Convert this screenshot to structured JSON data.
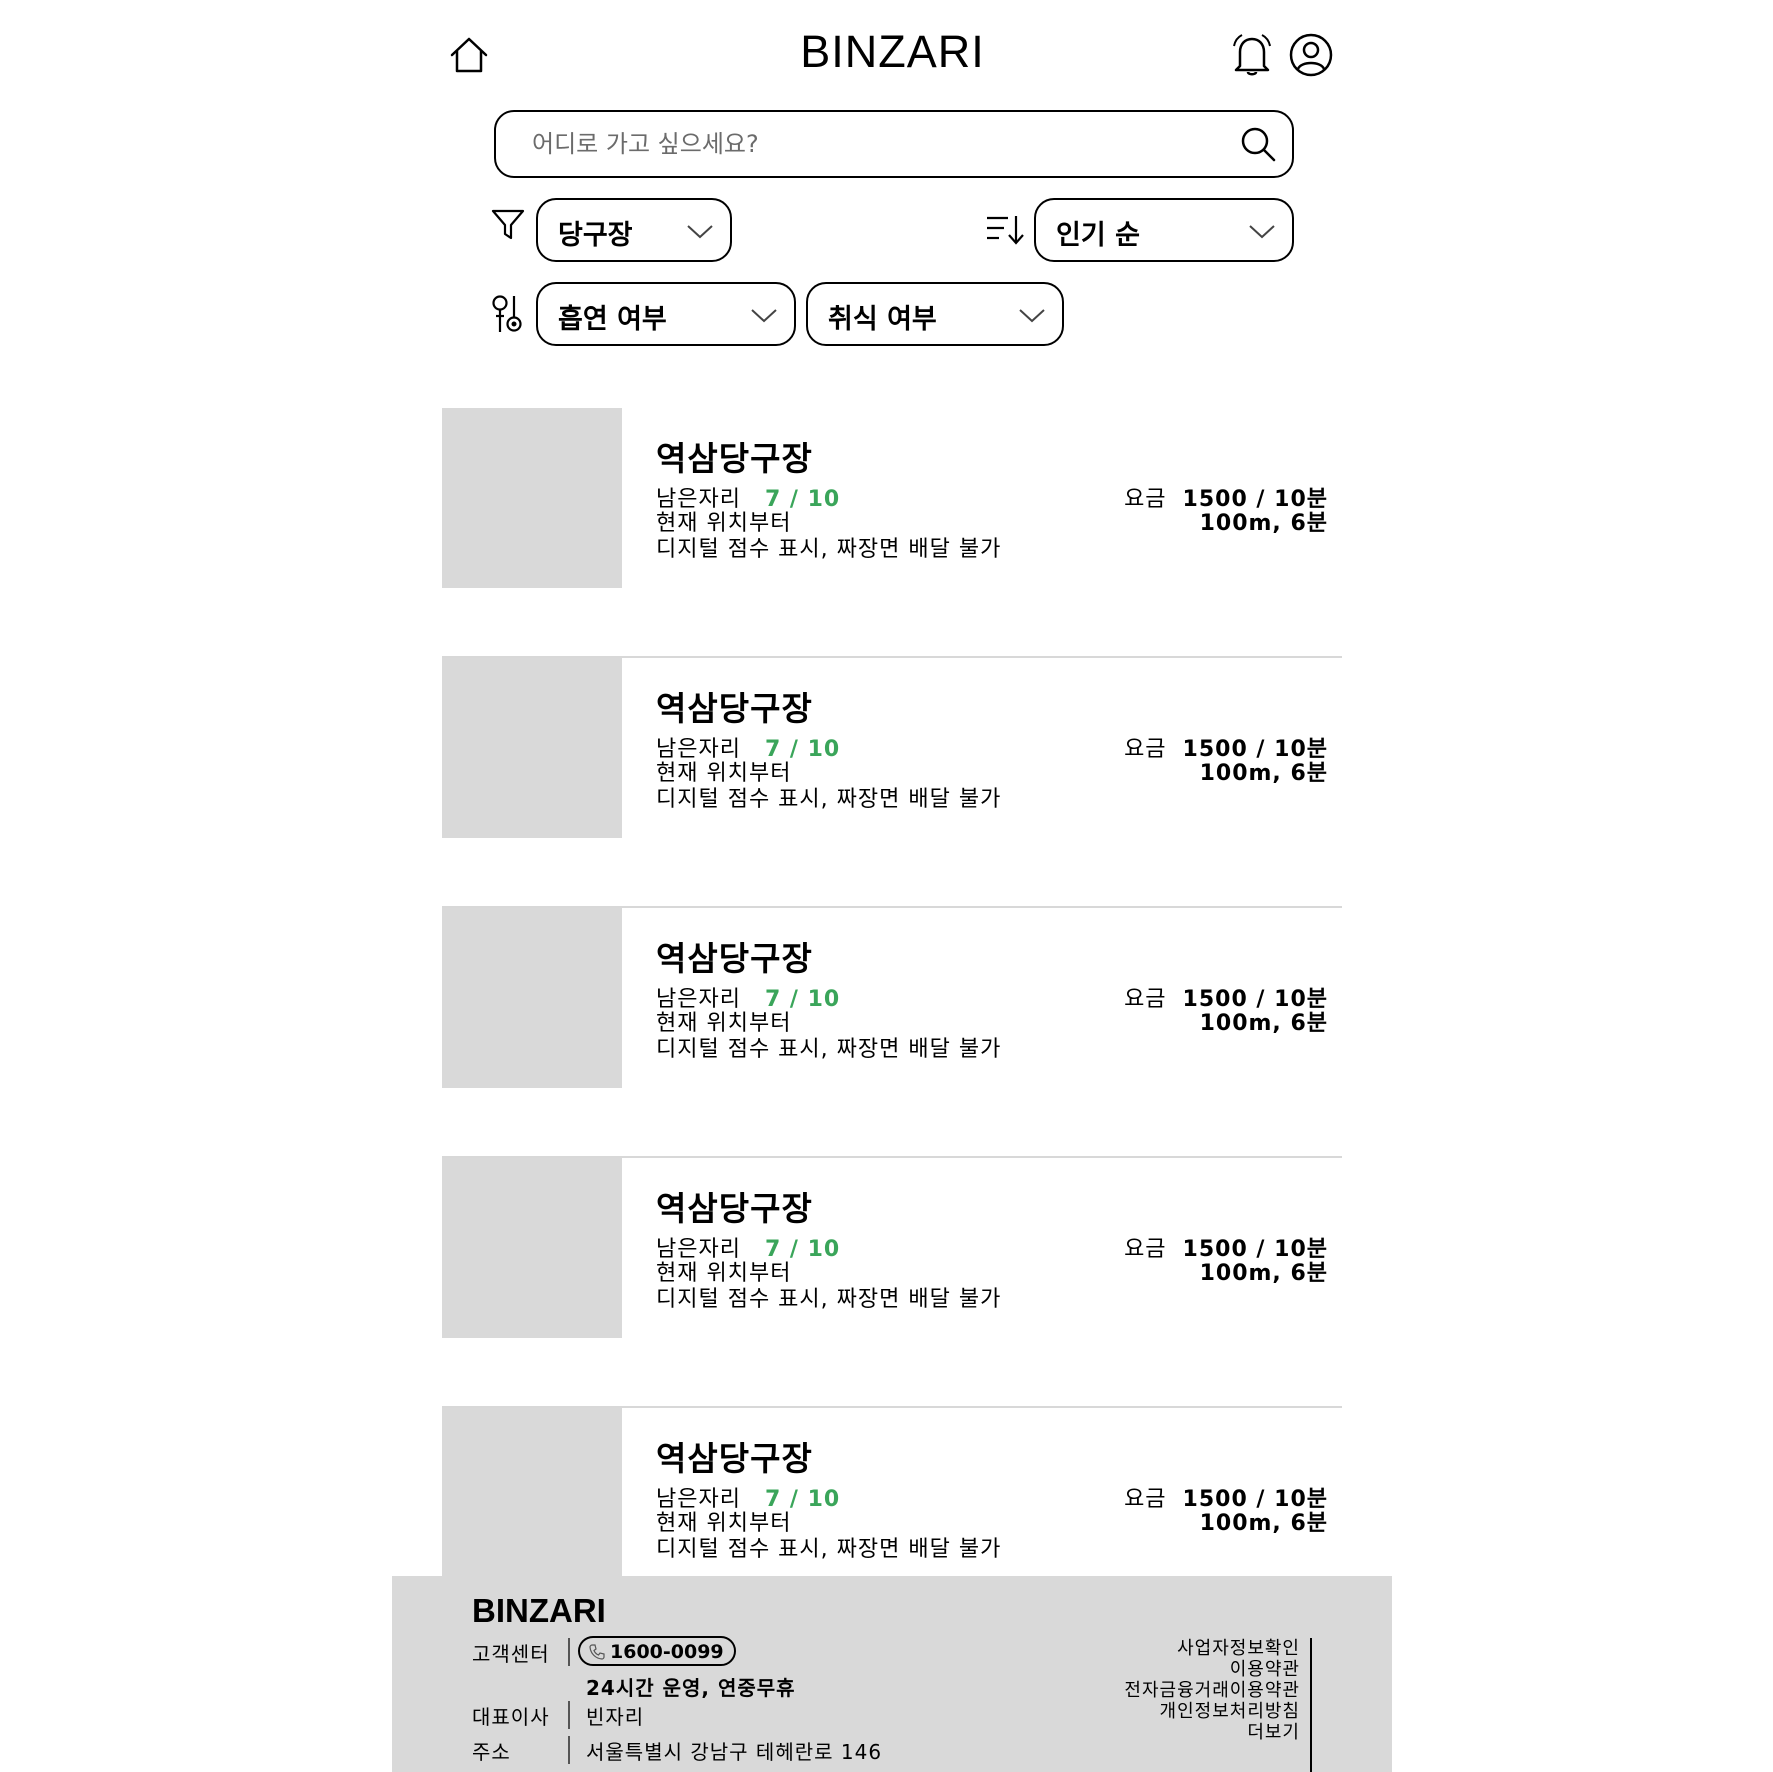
{
  "header": {
    "brand": "BINZARI",
    "icons": {
      "home": "home-icon",
      "bell": "bell-icon",
      "user": "user-icon"
    }
  },
  "search": {
    "placeholder": "어디로 가고 싶으세요?",
    "value": "",
    "icon": "search-icon"
  },
  "filters": {
    "category": {
      "icon": "filter-icon",
      "value": "당구장"
    },
    "sort": {
      "icon": "sort-icon",
      "value": "인기 순"
    },
    "smoking": {
      "icon": "options-icon",
      "value": "흡연 여부"
    },
    "eating": {
      "value": "취식 여부"
    }
  },
  "listings": [
    {
      "title": "역삼당구장",
      "seats_label": "남은자리",
      "seats": "7 / 10",
      "from_label": "현재 위치부터",
      "desc": "디지털 점수 표시, 짜장면 배달 불가",
      "fee_label": "요금",
      "fee": "1500 / 10분",
      "distance": "100m, 6분"
    },
    {
      "title": "역삼당구장",
      "seats_label": "남은자리",
      "seats": "7 / 10",
      "from_label": "현재 위치부터",
      "desc": "디지털 점수 표시, 짜장면 배달 불가",
      "fee_label": "요금",
      "fee": "1500 / 10분",
      "distance": "100m, 6분"
    },
    {
      "title": "역삼당구장",
      "seats_label": "남은자리",
      "seats": "7 / 10",
      "from_label": "현재 위치부터",
      "desc": "디지털 점수 표시, 짜장면 배달 불가",
      "fee_label": "요금",
      "fee": "1500 / 10분",
      "distance": "100m, 6분"
    },
    {
      "title": "역삼당구장",
      "seats_label": "남은자리",
      "seats": "7 / 10",
      "from_label": "현재 위치부터",
      "desc": "디지털 점수 표시, 짜장면 배달 불가",
      "fee_label": "요금",
      "fee": "1500 / 10분",
      "distance": "100m, 6분"
    },
    {
      "title": "역삼당구장",
      "seats_label": "남은자리",
      "seats": "7 / 10",
      "from_label": "현재 위치부터",
      "desc": "디지털 점수 표시, 짜장면 배달 불가",
      "fee_label": "요금",
      "fee": "1500 / 10분",
      "distance": "100m, 6분"
    }
  ],
  "footer": {
    "brand": "BINZARI",
    "support_label": "고객센터",
    "phone": "1600-0099",
    "hours": "24시간 운영, 연중무휴",
    "ceo_label": "대표이사",
    "ceo": "빈자리",
    "address_label": "주소",
    "address": "서울특별시 강남구 테헤란로 146",
    "links": [
      "사업자정보확인",
      "이용약관",
      "전자금융거래이용약관",
      "개인정보처리방침",
      "더보기"
    ]
  },
  "colors": {
    "accent_green": "#3aa55a",
    "thumb_gray": "#d9d9d9",
    "footer_gray": "#d9d9d9"
  }
}
